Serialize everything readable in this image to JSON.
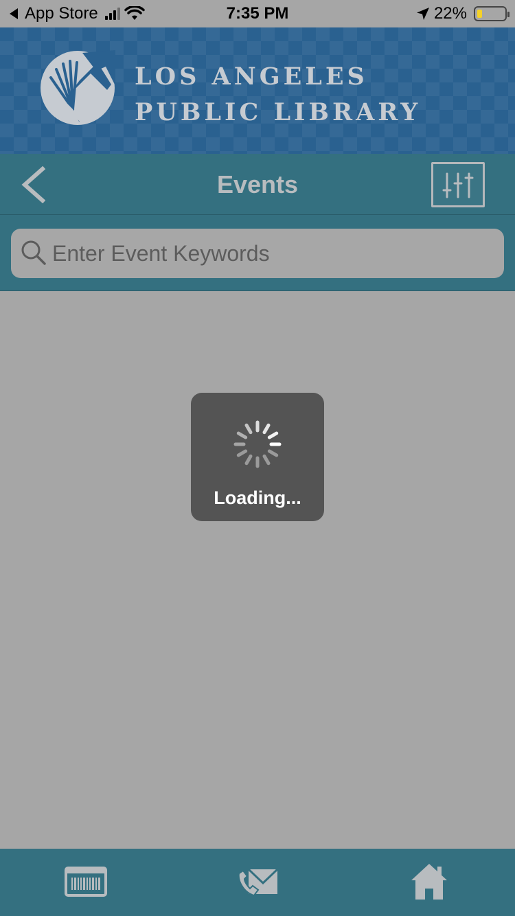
{
  "status_bar": {
    "back_app": "App Store",
    "time": "7:35 PM",
    "battery": "22%"
  },
  "banner": {
    "line1": "LOS ANGELES",
    "line2": "PUBLIC LIBRARY"
  },
  "nav": {
    "title": "Events"
  },
  "search": {
    "placeholder": "Enter Event Keywords",
    "value": ""
  },
  "loading": {
    "label": "Loading..."
  },
  "colors": {
    "banner": "#2a6190",
    "nav": "#347080",
    "overlay_bg": "#a6a6a6",
    "hud": "#545454",
    "icon": "#b8bcbf"
  },
  "tabs": [
    {
      "icon": "library-card-icon"
    },
    {
      "icon": "contact-icon"
    },
    {
      "icon": "home-icon"
    }
  ]
}
